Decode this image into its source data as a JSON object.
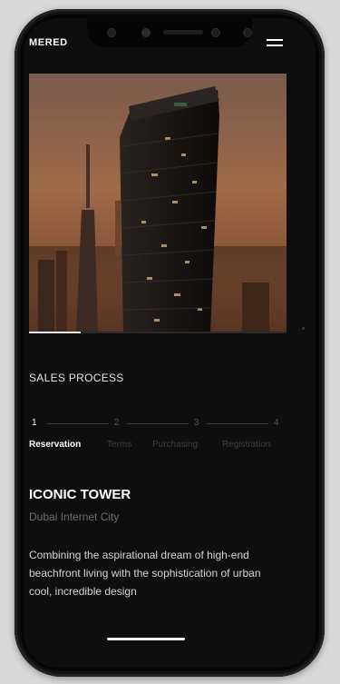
{
  "app": {
    "brand": "MERED"
  },
  "header": {
    "menu_icon": "hamburger-menu-icon"
  },
  "hero": {
    "image_subject": "skyscraper at dusk",
    "progress_fraction": 0.2
  },
  "sales_process": {
    "title": "SALES PROCESS",
    "steps": [
      "1",
      "2",
      "3",
      "4"
    ],
    "active_step": 1,
    "tabs": [
      "Reservation",
      "Terms",
      "Purchasing",
      "Registration"
    ]
  },
  "property": {
    "name": "ICONIC TOWER",
    "location": "Dubai Internet City",
    "description": "Combining the aspirational dream of high-end beachfront living with the sophistication of urban cool, incredible design"
  },
  "colors": {
    "background": "#0e0e0e",
    "text": "#ffffff",
    "muted": "#6d6d6d"
  }
}
